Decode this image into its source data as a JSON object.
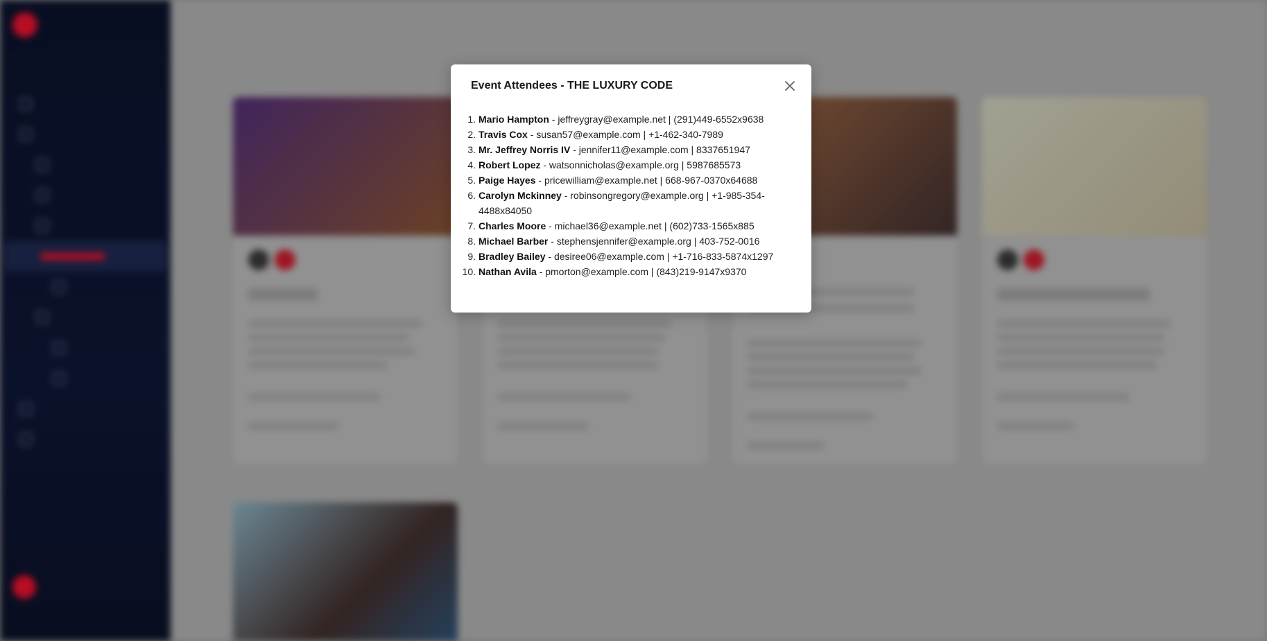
{
  "modal": {
    "title": "Event Attendees - THE LUXURY CODE",
    "close_icon": "close-icon",
    "attendees": [
      {
        "num": "1.",
        "name": "Mario Hampton",
        "details": " - jeffreygray@example.net | (291)449-6552x9638"
      },
      {
        "num": "2.",
        "name": "Travis Cox",
        "details": " - susan57@example.com | +1-462-340-7989"
      },
      {
        "num": "3.",
        "name": "Mr. Jeffrey Norris IV",
        "details": " - jennifer11@example.com | 8337651947"
      },
      {
        "num": "4.",
        "name": "Robert Lopez",
        "details": " - watsonnicholas@example.org | 5987685573"
      },
      {
        "num": "5.",
        "name": "Paige Hayes",
        "details": " - pricewilliam@example.net | 668-967-0370x64688"
      },
      {
        "num": "6.",
        "name": "Carolyn Mckinney",
        "details": " - robinsongregory@example.org | +1-985-354-4488x84050"
      },
      {
        "num": "7.",
        "name": "Charles Moore",
        "details": " - michael36@example.net | (602)733-1565x885"
      },
      {
        "num": "8.",
        "name": "Michael Barber",
        "details": " - stephensjennifer@example.org | 403-752-0016"
      },
      {
        "num": "9.",
        "name": "Bradley Bailey",
        "details": " - desiree06@example.com | +1-716-833-5874x1297"
      },
      {
        "num": "10.",
        "name": "Nathan Avila",
        "details": " - pmorton@example.com | (843)219-9147x9370"
      }
    ]
  },
  "colors": {
    "sidebar_bg": "#0a1126",
    "accent_red": "#d0102a",
    "modal_bg": "#ffffff",
    "overlay": "rgba(0,0,0,0.12)"
  }
}
